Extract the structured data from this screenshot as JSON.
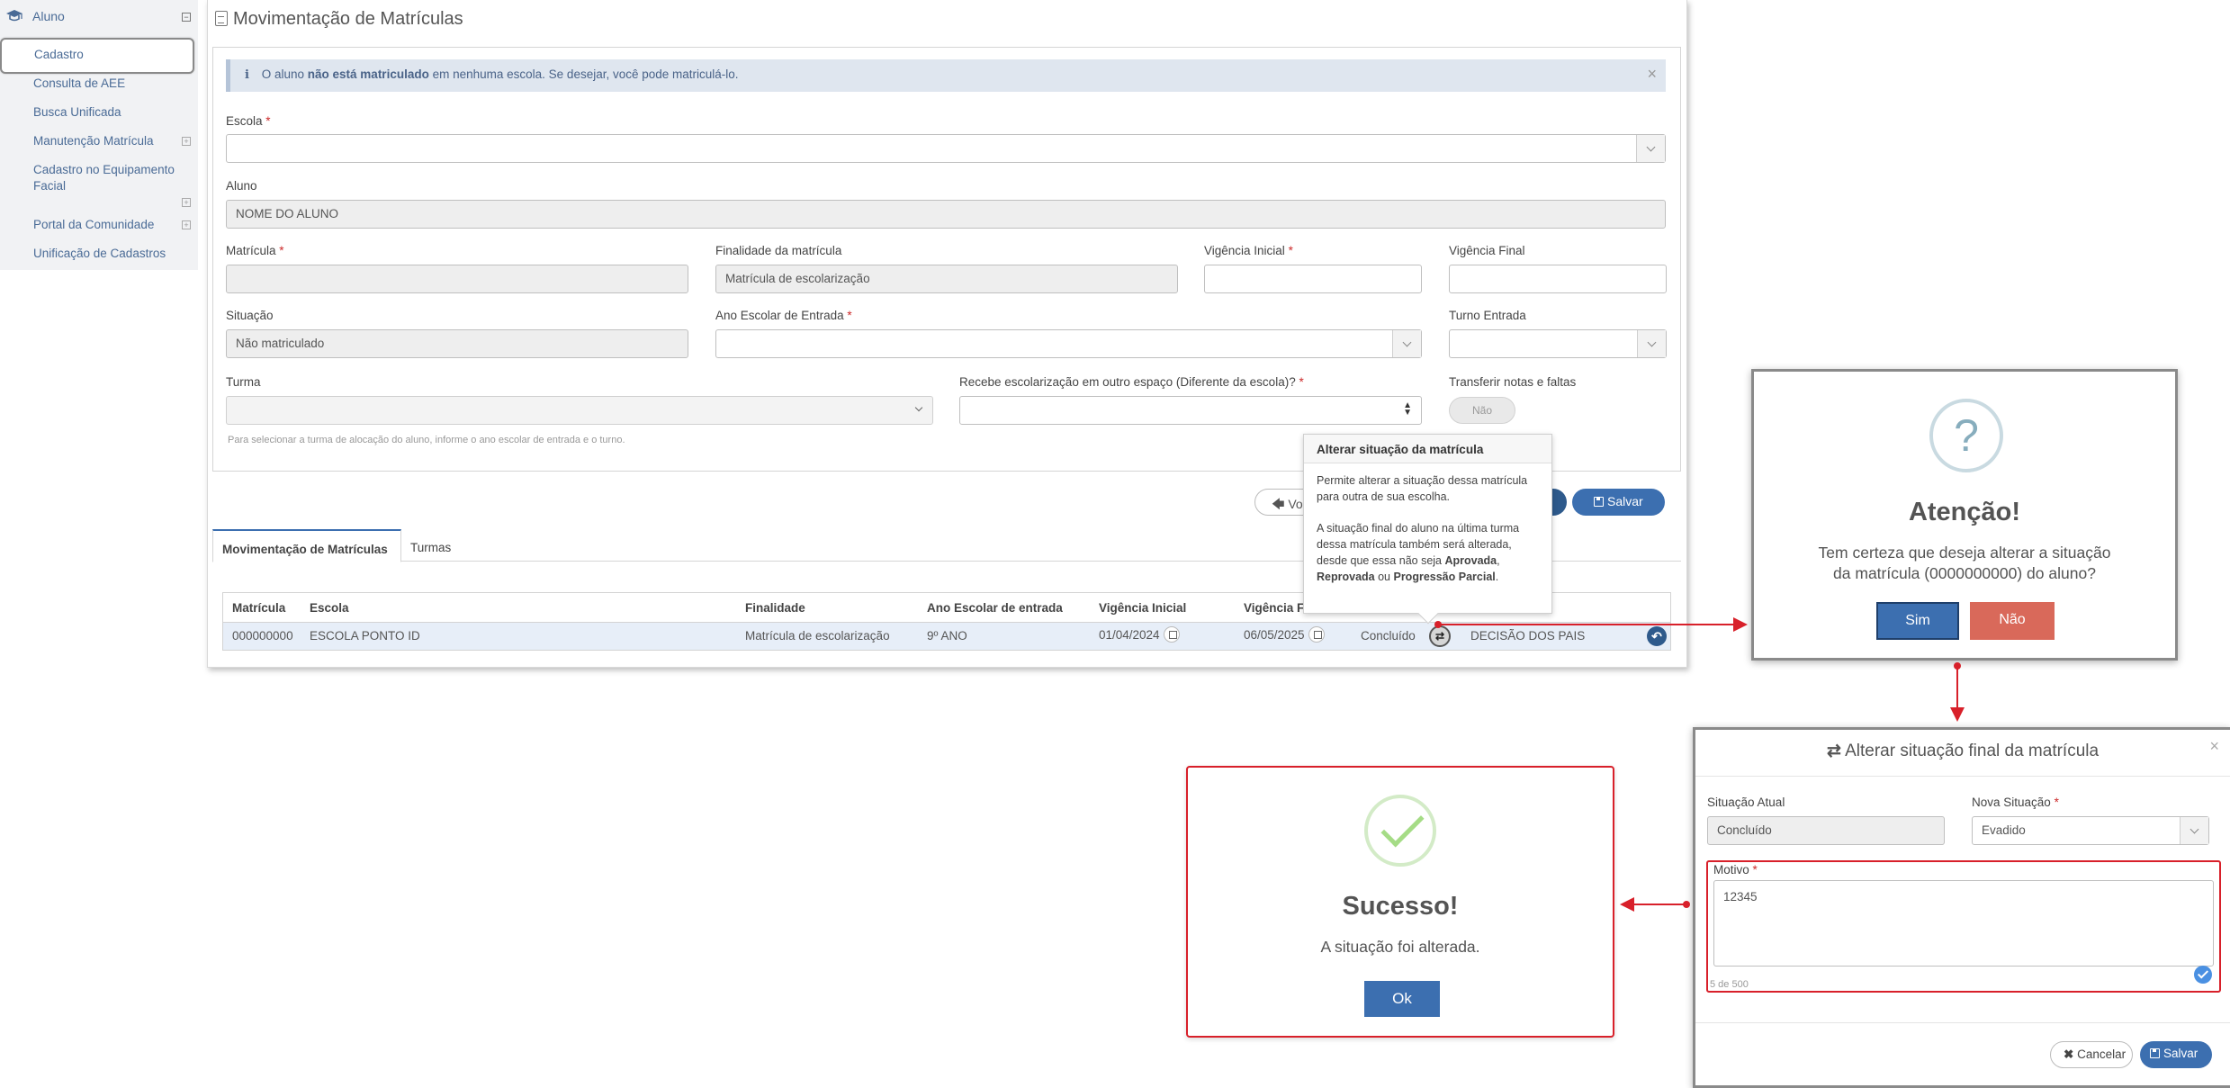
{
  "sidebar": {
    "section": "Aluno",
    "items": [
      {
        "label": "Cadastro"
      },
      {
        "label": "Consulta de AEE"
      },
      {
        "label": "Busca Unificada"
      },
      {
        "label": "Manutenção Matrícula"
      },
      {
        "label": "Cadastro no Equipamento"
      },
      {
        "label": "Facial"
      },
      {
        "label": "Portal da Comunidade"
      },
      {
        "label": "Unificação de Cadastros"
      }
    ]
  },
  "page": {
    "title": "Movimentação de Matrículas"
  },
  "alert": {
    "pre": "O aluno",
    "bold": "não está matriculado",
    "post": "em nenhuma escola. Se desejar, você pode matriculá-lo.",
    "close": "×"
  },
  "form": {
    "escola_label": "Escola",
    "aluno_label": "Aluno",
    "aluno_value": "NOME DO ALUNO",
    "matricula_label": "Matrícula",
    "finalidade_label": "Finalidade da matrícula",
    "finalidade_value": "Matrícula de escolarização",
    "vig_ini_label": "Vigência Inicial",
    "vig_fim_label": "Vigência Final",
    "situacao_label": "Situação",
    "situacao_value": "Não matriculado",
    "ano_label": "Ano Escolar de Entrada",
    "turno_label": "Turno Entrada",
    "turma_label": "Turma",
    "recebe_label": "Recebe escolarização em outro espaço (Diferente da escola)?",
    "transferir_label": "Transferir notas e faltas",
    "transferir_value": "Não",
    "turma_hint": "Para selecionar a turma de alocação do aluno, informe o ano escolar de entrada e o turno.",
    "req": "*"
  },
  "actions": {
    "voltar": "Vo",
    "salvar": "Salvar"
  },
  "tabs": [
    {
      "label": "Movimentação de Matrículas"
    },
    {
      "label": "Turmas"
    }
  ],
  "table": {
    "headers": [
      "Matrícula",
      "Escola",
      "Finalidade",
      "Ano Escolar de entrada",
      "Vigência Inicial",
      "Vigência Fi"
    ],
    "row": {
      "matricula": "000000000",
      "escola": "ESCOLA PONTO ID",
      "finalidade": "Matrícula de escolarização",
      "ano": "9º ANO",
      "vig_ini": "01/04/2024",
      "vig_fim": "06/05/2025",
      "situacao": "Concluído",
      "motivo": "DECISÃO DOS PAIS"
    }
  },
  "tooltip": {
    "title": "Alterar situação da matrícula",
    "p1": "Permite alterar a situação dessa matrícula para outra de sua escolha.",
    "p2_pre": "A situação final do aluno na última turma dessa matrícula também será alterada, desde que essa não seja",
    "b1": "Aprovada",
    "sep1": ",",
    "b2": "Reprovada",
    "ou": "ou",
    "b3": "Progressão Parcial",
    "end": "."
  },
  "confirm": {
    "icon": "?",
    "title": "Atenção!",
    "text": "Tem certeza que deseja alterar a situação da matrícula (0000000000) do aluno?",
    "yes": "Sim",
    "no": "Não"
  },
  "success": {
    "title": "Sucesso!",
    "text": "A situação foi alterada.",
    "ok": "Ok"
  },
  "alter_modal": {
    "title": "Alterar situação final da matrícula",
    "close": "×",
    "atual_label": "Situação Atual",
    "atual_value": "Concluído",
    "nova_label": "Nova Situação",
    "nova_value": "Evadido",
    "motivo_label": "Motivo",
    "motivo_value": "12345",
    "counter": "5 de 500",
    "cancel": "Cancelar",
    "save": "Salvar"
  },
  "colors": {
    "accent": "#3c6fb0",
    "danger": "#d8202a",
    "no_button": "#d9695a"
  }
}
